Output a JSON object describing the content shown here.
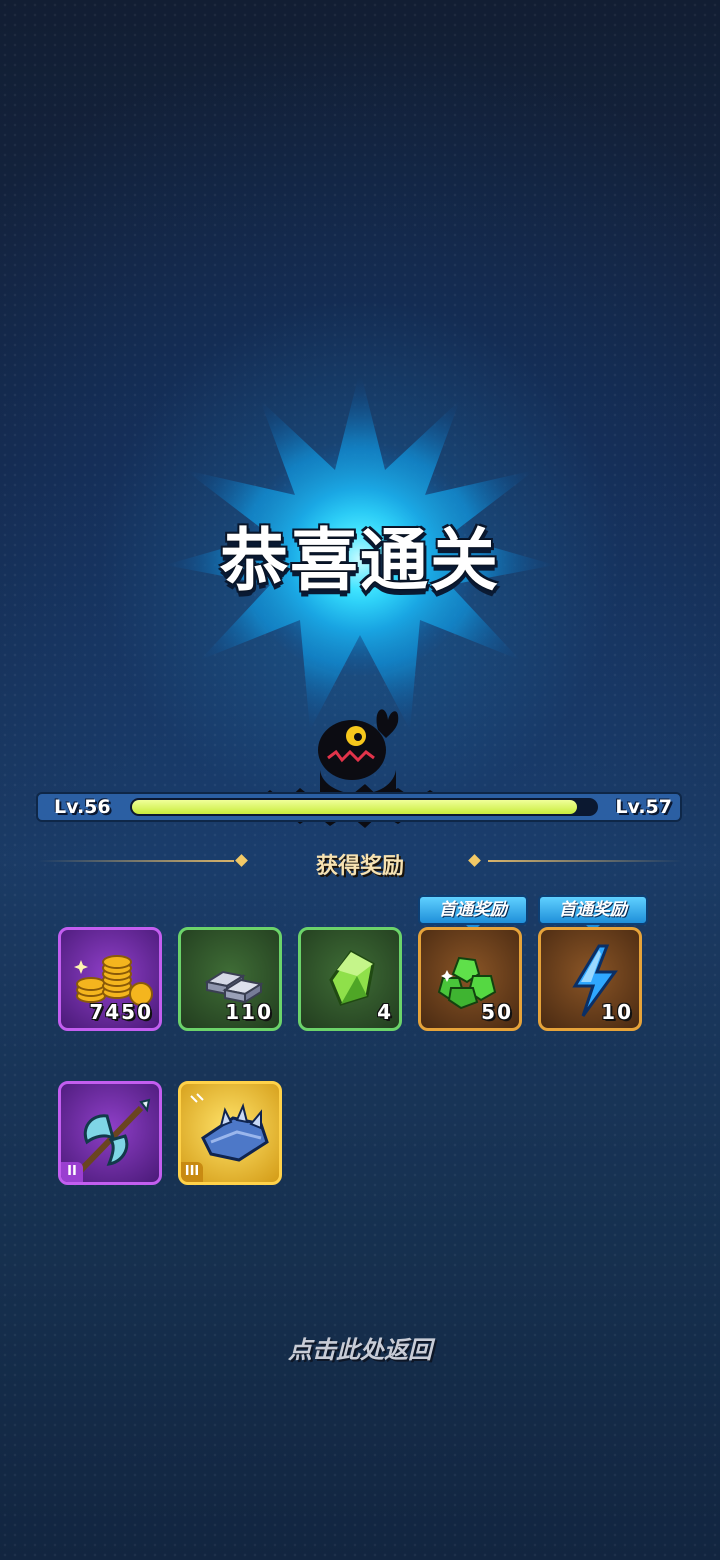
{
  "result": {
    "title": "恭喜通关"
  },
  "level": {
    "current": "Lv.56",
    "next": "Lv.57",
    "progress": 0.96
  },
  "rewards": {
    "header": "获得奖励",
    "first_clear_badge": "首通奖励",
    "items": [
      {
        "name": "gold-coins",
        "quantity": "7450",
        "frame": "purple"
      },
      {
        "name": "iron-ingots",
        "quantity": "110",
        "frame": "green"
      },
      {
        "name": "green-crystal",
        "quantity": "4",
        "frame": "green"
      },
      {
        "name": "emerald-gems",
        "quantity": "50",
        "frame": "brown",
        "first_clear": true
      },
      {
        "name": "energy-bolt",
        "quantity": "10",
        "frame": "brown",
        "first_clear": true
      }
    ],
    "equipment": [
      {
        "name": "battle-axe",
        "tier": "II",
        "frame": "purple"
      },
      {
        "name": "spiked-gauntlet",
        "tier": "III",
        "frame": "gold"
      }
    ]
  },
  "footer": {
    "return_hint": "点击此处返回"
  },
  "colors": {
    "progress_fill": "#d4f25a",
    "burst": "#27d8ff",
    "badge": "#38b4f2"
  }
}
